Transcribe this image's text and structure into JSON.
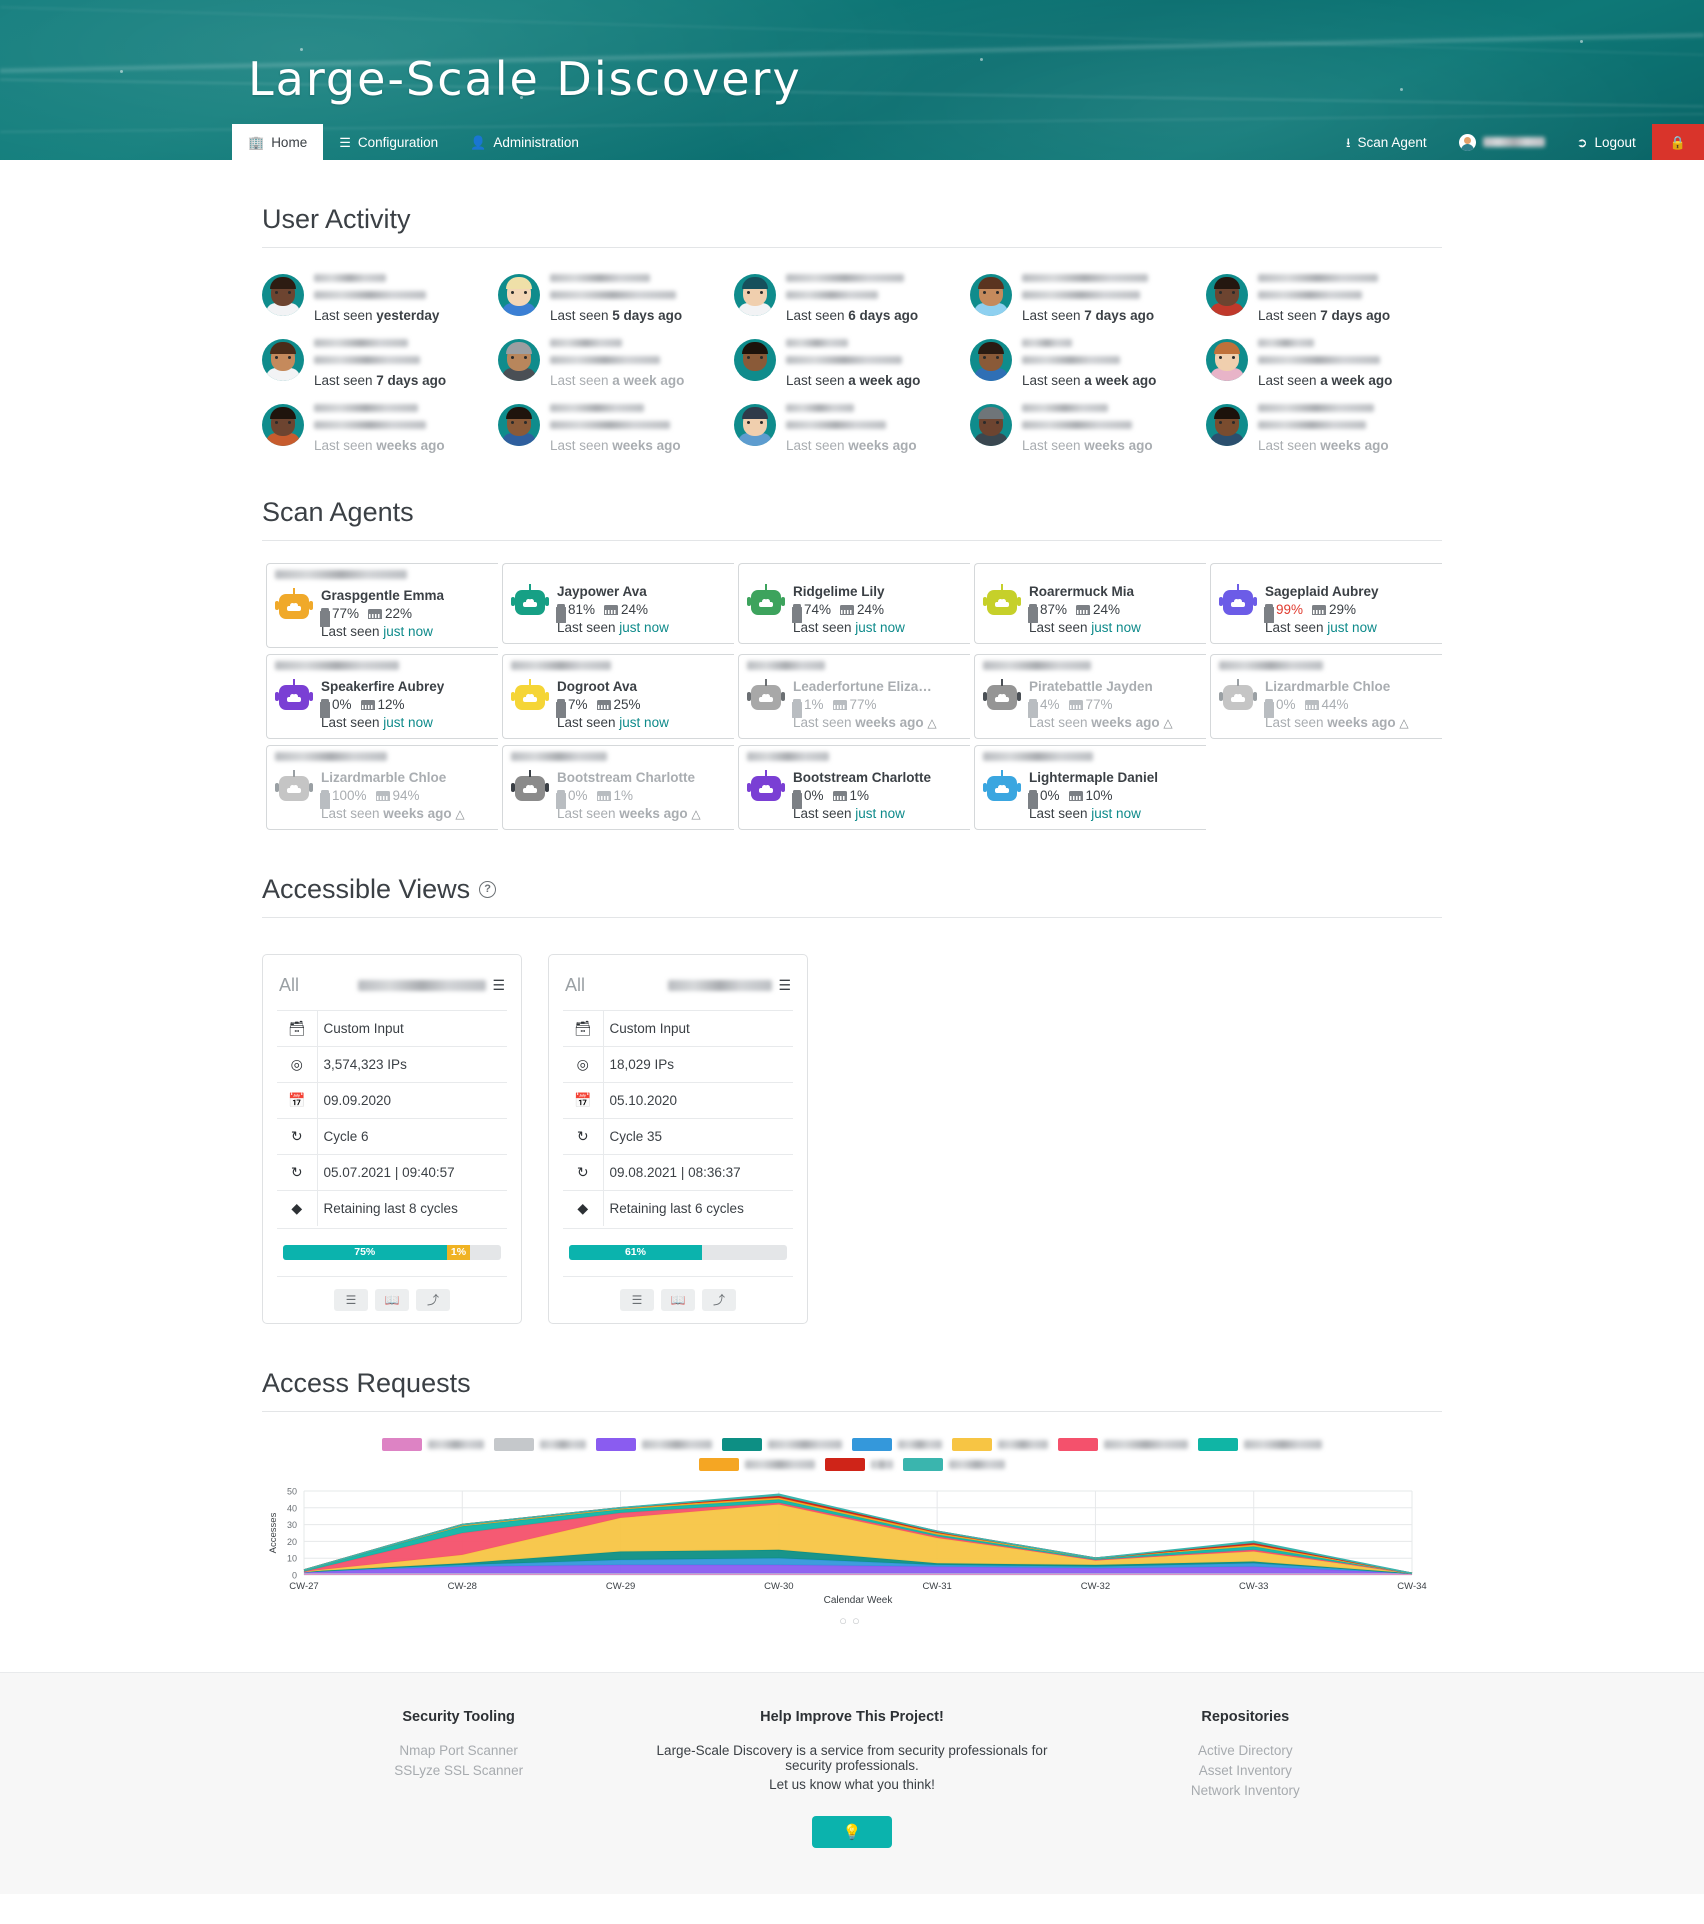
{
  "app": {
    "title": "Large-Scale Discovery"
  },
  "nav": {
    "left": [
      {
        "label": "Home",
        "icon": "home-icon",
        "active": true
      },
      {
        "label": "Configuration",
        "icon": "sliders-icon",
        "active": false
      },
      {
        "label": "Administration",
        "icon": "user-gear-icon",
        "active": false
      }
    ],
    "right": [
      {
        "label": "Scan Agent",
        "icon": "download-icon"
      },
      {
        "label": "",
        "icon": "avatar-icon",
        "redacted": true
      },
      {
        "label": "Logout",
        "icon": "logout-icon"
      }
    ],
    "lock_button": {
      "label": "",
      "icon": "lock-icon",
      "color": "#d9342b"
    }
  },
  "sections": {
    "user_activity": "User Activity",
    "scan_agents": "Scan Agents",
    "accessible_views": "Accessible Views",
    "access_requests": "Access Requests"
  },
  "user_activity": {
    "prefix": "Last seen",
    "users": [
      {
        "last_seen": "yesterday",
        "faded": false,
        "skin": "#6d4430",
        "hair": "#2d1c12",
        "shirt": "#f2f3f5",
        "bg": "#0f8c8c",
        "n1": 72,
        "n2": 112
      },
      {
        "last_seen": "5 days ago",
        "faded": false,
        "skin": "#f3d6b6",
        "hair": "#efe0a8",
        "shirt": "#3b7fd4",
        "bg": "#0f8c8c",
        "n1": 100,
        "n2": 126
      },
      {
        "last_seen": "6 days ago",
        "faded": false,
        "skin": "#f0cfae",
        "hair": "#16505c",
        "shirt": "#f2f3f5",
        "bg": "#0f8c8c",
        "n1": 118,
        "n2": 92
      },
      {
        "last_seen": "7 days ago",
        "faded": false,
        "skin": "#c58a5c",
        "hair": "#5a3420",
        "shirt": "#8ed0f0",
        "bg": "#0f8c8c",
        "n1": 126,
        "n2": 118
      },
      {
        "last_seen": "7 days ago",
        "faded": false,
        "skin": "#6d4430",
        "hair": "#241710",
        "shirt": "#c0392b",
        "bg": "#0f8c8c",
        "n1": 120,
        "n2": 104
      },
      {
        "last_seen": "7 days ago",
        "faded": false,
        "skin": "#c58a5c",
        "hair": "#4a2c19",
        "shirt": "#f2f3f5",
        "bg": "#0f8c8c",
        "n1": 94,
        "n2": 106
      },
      {
        "last_seen": "a week ago",
        "faded": true,
        "skin": "#b8865c",
        "hair": "#9b9ea1",
        "shirt": "#4a4f55",
        "bg": "#0f8c8c",
        "n1": 72,
        "n2": 110
      },
      {
        "last_seen": "a week ago",
        "faded": false,
        "skin": "#8a5a38",
        "hair": "#1c120b",
        "shirt": "#0f8c8c",
        "bg": "#0f8c8c",
        "n1": 62,
        "n2": 116
      },
      {
        "last_seen": "a week ago",
        "faded": false,
        "skin": "#8a5a38",
        "hair": "#2a1b12",
        "shirt": "#2f6fb5",
        "bg": "#0f8c8c",
        "n1": 50,
        "n2": 98
      },
      {
        "last_seen": "a week ago",
        "faded": false,
        "skin": "#f0cfae",
        "hair": "#c0713a",
        "shirt": "#e8b4c8",
        "bg": "#0f8c8c",
        "n1": 56,
        "n2": 122
      },
      {
        "last_seen": "weeks ago",
        "faded": true,
        "skin": "#6d4430",
        "hair": "#1f140d",
        "shirt": "#c75c2e",
        "bg": "#0f8c8c",
        "n1": 104,
        "n2": 112
      },
      {
        "last_seen": "weeks ago",
        "faded": true,
        "skin": "#8a5a38",
        "hair": "#1f140d",
        "shirt": "#2f5f9e",
        "bg": "#0f8c8c",
        "n1": 94,
        "n2": 120
      },
      {
        "last_seen": "weeks ago",
        "faded": true,
        "skin": "#f0cfae",
        "hair": "#2f3b4a",
        "shirt": "#5d9ccf",
        "bg": "#0f8c8c",
        "n1": 68,
        "n2": 100
      },
      {
        "last_seen": "weeks ago",
        "faded": true,
        "skin": "#6d4430",
        "hair": "#6f7579",
        "shirt": "#3a4750",
        "bg": "#0f8c8c",
        "n1": 86,
        "n2": 110
      },
      {
        "last_seen": "weeks ago",
        "faded": true,
        "skin": "#7a4c2e",
        "hair": "#1c120b",
        "shirt": "#2b4f6e",
        "bg": "#0f8c8c",
        "n1": 116,
        "n2": 108
      }
    ]
  },
  "scan_agents": {
    "prefix": "Last seen",
    "agents": [
      {
        "name": "Graspgentle Emma",
        "cpu": "77%",
        "mem": "22%",
        "last_seen": "just now",
        "state": "online",
        "cpu_hot": false,
        "clean": false,
        "color": "#f0a92a",
        "host_w": 132
      },
      {
        "name": "Jaypower Ava",
        "cpu": "81%",
        "mem": "24%",
        "last_seen": "just now",
        "state": "online",
        "cpu_hot": false,
        "clean": false,
        "color": "#16a085",
        "host_w": 0
      },
      {
        "name": "Ridgelime Lily",
        "cpu": "74%",
        "mem": "24%",
        "last_seen": "just now",
        "state": "online",
        "cpu_hot": false,
        "clean": false,
        "color": "#3da35d",
        "host_w": 0
      },
      {
        "name": "Roarermuck Mia",
        "cpu": "87%",
        "mem": "24%",
        "last_seen": "just now",
        "state": "online",
        "cpu_hot": false,
        "clean": false,
        "color": "#c6d02a",
        "host_w": 0
      },
      {
        "name": "Sageplaid Aubrey",
        "cpu": "99%",
        "mem": "29%",
        "last_seen": "just now",
        "state": "online",
        "cpu_hot": true,
        "clean": false,
        "color": "#6c5ce7",
        "host_w": 0
      },
      {
        "name": "Speakerfire Aubrey",
        "cpu": "0%",
        "mem": "12%",
        "last_seen": "just now",
        "state": "online",
        "cpu_hot": false,
        "clean": false,
        "color": "#7a3fd4",
        "host_w": 124
      },
      {
        "name": "Dogroot Ava",
        "cpu": "7%",
        "mem": "25%",
        "last_seen": "just now",
        "state": "online",
        "cpu_hot": false,
        "clean": false,
        "color": "#f5d536",
        "host_w": 100
      },
      {
        "name": "Leaderfortune Elizabe...",
        "cpu": "1%",
        "mem": "77%",
        "last_seen": "weeks ago",
        "state": "offline",
        "cpu_hot": false,
        "clean": true,
        "color": "#6b6f73",
        "host_w": 78
      },
      {
        "name": "Piratebattle Jayden",
        "cpu": "4%",
        "mem": "77%",
        "last_seen": "weeks ago",
        "state": "offline",
        "cpu_hot": false,
        "clean": true,
        "color": "#4a4f55",
        "host_w": 108
      },
      {
        "name": "Lizardmarble Chloe",
        "cpu": "0%",
        "mem": "44%",
        "last_seen": "weeks ago",
        "state": "offline",
        "cpu_hot": false,
        "clean": true,
        "color": "#9aa0a4",
        "host_w": 104
      },
      {
        "name": "Lizardmarble Chloe",
        "cpu": "100%",
        "mem": "94%",
        "last_seen": "weeks ago",
        "state": "offline",
        "cpu_hot": false,
        "clean": true,
        "color": "#9aa0a4",
        "host_w": 112
      },
      {
        "name": "Bootstream Charlotte",
        "cpu": "0%",
        "mem": "1%",
        "last_seen": "weeks ago",
        "state": "offline",
        "cpu_hot": false,
        "clean": true,
        "color": "#3a3f45",
        "host_w": 96
      },
      {
        "name": "Bootstream Charlotte",
        "cpu": "0%",
        "mem": "1%",
        "last_seen": "just now",
        "state": "online",
        "cpu_hot": false,
        "clean": false,
        "color": "#7a3fd4",
        "host_w": 82
      },
      {
        "name": "Lightermaple Daniel",
        "cpu": "0%",
        "mem": "10%",
        "last_seen": "just now",
        "state": "online",
        "cpu_hot": false,
        "clean": false,
        "color": "#3aa6e0",
        "host_w": 110
      }
    ]
  },
  "accessible_views": [
    {
      "scope": "All",
      "name_redacted": true,
      "name_width": 128,
      "rows": [
        {
          "icon": "archive-icon",
          "value": "Custom Input"
        },
        {
          "icon": "target-icon",
          "value": "3,574,323 IPs"
        },
        {
          "icon": "calendar-icon",
          "value": "09.09.2020"
        },
        {
          "icon": "cycle-icon",
          "value": "Cycle 6"
        },
        {
          "icon": "cycle-end-icon",
          "value": "05.07.2021 | 09:40:57"
        },
        {
          "icon": "broom-icon",
          "value": "Retaining last 8 cycles"
        }
      ],
      "progress": [
        {
          "label": "75%",
          "pct": 75,
          "color": "#0bb3ad"
        },
        {
          "label": "1%",
          "pct": 11,
          "color": "#f0b323"
        }
      ],
      "actions": [
        {
          "icon": "database-icon"
        },
        {
          "icon": "book-icon"
        },
        {
          "icon": "share-icon"
        }
      ]
    },
    {
      "scope": "All",
      "name_redacted": true,
      "name_width": 104,
      "rows": [
        {
          "icon": "archive-icon",
          "value": "Custom Input"
        },
        {
          "icon": "target-icon",
          "value": "18,029 IPs"
        },
        {
          "icon": "calendar-icon",
          "value": "05.10.2020"
        },
        {
          "icon": "cycle-icon",
          "value": "Cycle 35"
        },
        {
          "icon": "cycle-end-icon",
          "value": "09.08.2021 | 08:36:37"
        },
        {
          "icon": "broom-icon",
          "value": "Retaining last 6 cycles"
        }
      ],
      "progress": [
        {
          "label": "61%",
          "pct": 61,
          "color": "#0bb3ad"
        }
      ],
      "actions": [
        {
          "icon": "database-icon"
        },
        {
          "icon": "book-icon"
        },
        {
          "icon": "share-icon"
        }
      ]
    }
  ],
  "chart_data": {
    "type": "area",
    "title": "Access Requests",
    "xlabel": "Calendar Week",
    "ylabel": "Accesses",
    "ylim": [
      0,
      50
    ],
    "yticks": [
      0,
      10,
      20,
      30,
      40,
      50
    ],
    "grid": true,
    "legend_position": "top",
    "categories": [
      "CW-27",
      "CW-28",
      "CW-29",
      "CW-30",
      "CW-31",
      "CW-32",
      "CW-33",
      "CW-34"
    ],
    "series": [
      {
        "name": "",
        "redacted": true,
        "label_width": 56,
        "color": "#dd83c4",
        "values": [
          1,
          1,
          1,
          1,
          1,
          1,
          1,
          1
        ]
      },
      {
        "name": "",
        "redacted": true,
        "label_width": 46,
        "color": "#c5c8cb",
        "values": [
          0,
          0,
          0,
          0,
          0,
          0,
          0,
          0
        ]
      },
      {
        "name": "",
        "redacted": true,
        "label_width": 70,
        "color": "#8a5cf0",
        "values": [
          1,
          4,
          5,
          5,
          4,
          3,
          4,
          0
        ]
      },
      {
        "name": "",
        "redacted": true,
        "label_width": 74,
        "color": "#0d8f84",
        "values": [
          0,
          1,
          5,
          5,
          1,
          1,
          1,
          0
        ]
      },
      {
        "name": "",
        "redacted": true,
        "label_width": 44,
        "color": "#3498db",
        "values": [
          0,
          1,
          3,
          4,
          1,
          1,
          2,
          0
        ]
      },
      {
        "name": "",
        "redacted": true,
        "label_width": 50,
        "color": "#f7c544",
        "values": [
          0,
          5,
          20,
          27,
          15,
          3,
          6,
          0
        ]
      },
      {
        "name": "",
        "redacted": true,
        "label_width": 84,
        "color": "#f4516c",
        "values": [
          0,
          13,
          3,
          1,
          1,
          0,
          1,
          0
        ]
      },
      {
        "name": "",
        "redacted": true,
        "label_width": 78,
        "color": "#10b5a5",
        "values": [
          1,
          4,
          2,
          2,
          1,
          1,
          2,
          0
        ]
      },
      {
        "name": "",
        "redacted": true,
        "label_width": 70,
        "color": "#f5a623",
        "values": [
          0,
          1,
          1,
          1,
          1,
          0,
          1,
          0
        ]
      },
      {
        "name": "",
        "redacted": true,
        "label_width": 22,
        "color": "#cf2418",
        "values": [
          0,
          0,
          0,
          1,
          1,
          0,
          1,
          0
        ]
      },
      {
        "name": "",
        "redacted": true,
        "label_width": 56,
        "color": "#3ab5ae",
        "values": [
          0,
          0,
          0,
          1,
          0,
          0,
          1,
          0
        ]
      }
    ]
  },
  "footer": {
    "left": {
      "title": "Security Tooling",
      "links": [
        "Nmap Port Scanner",
        "SSLyze SSL Scanner"
      ]
    },
    "center": {
      "title": "Help Improve This Project!",
      "line1": "Large-Scale Discovery is a service from security professionals for security professionals.",
      "line2": "Let us know what you think!",
      "button_icon": "lightbulb-icon"
    },
    "right": {
      "title": "Repositories",
      "links": [
        "Active Directory",
        "Asset Inventory",
        "Network Inventory"
      ]
    }
  }
}
